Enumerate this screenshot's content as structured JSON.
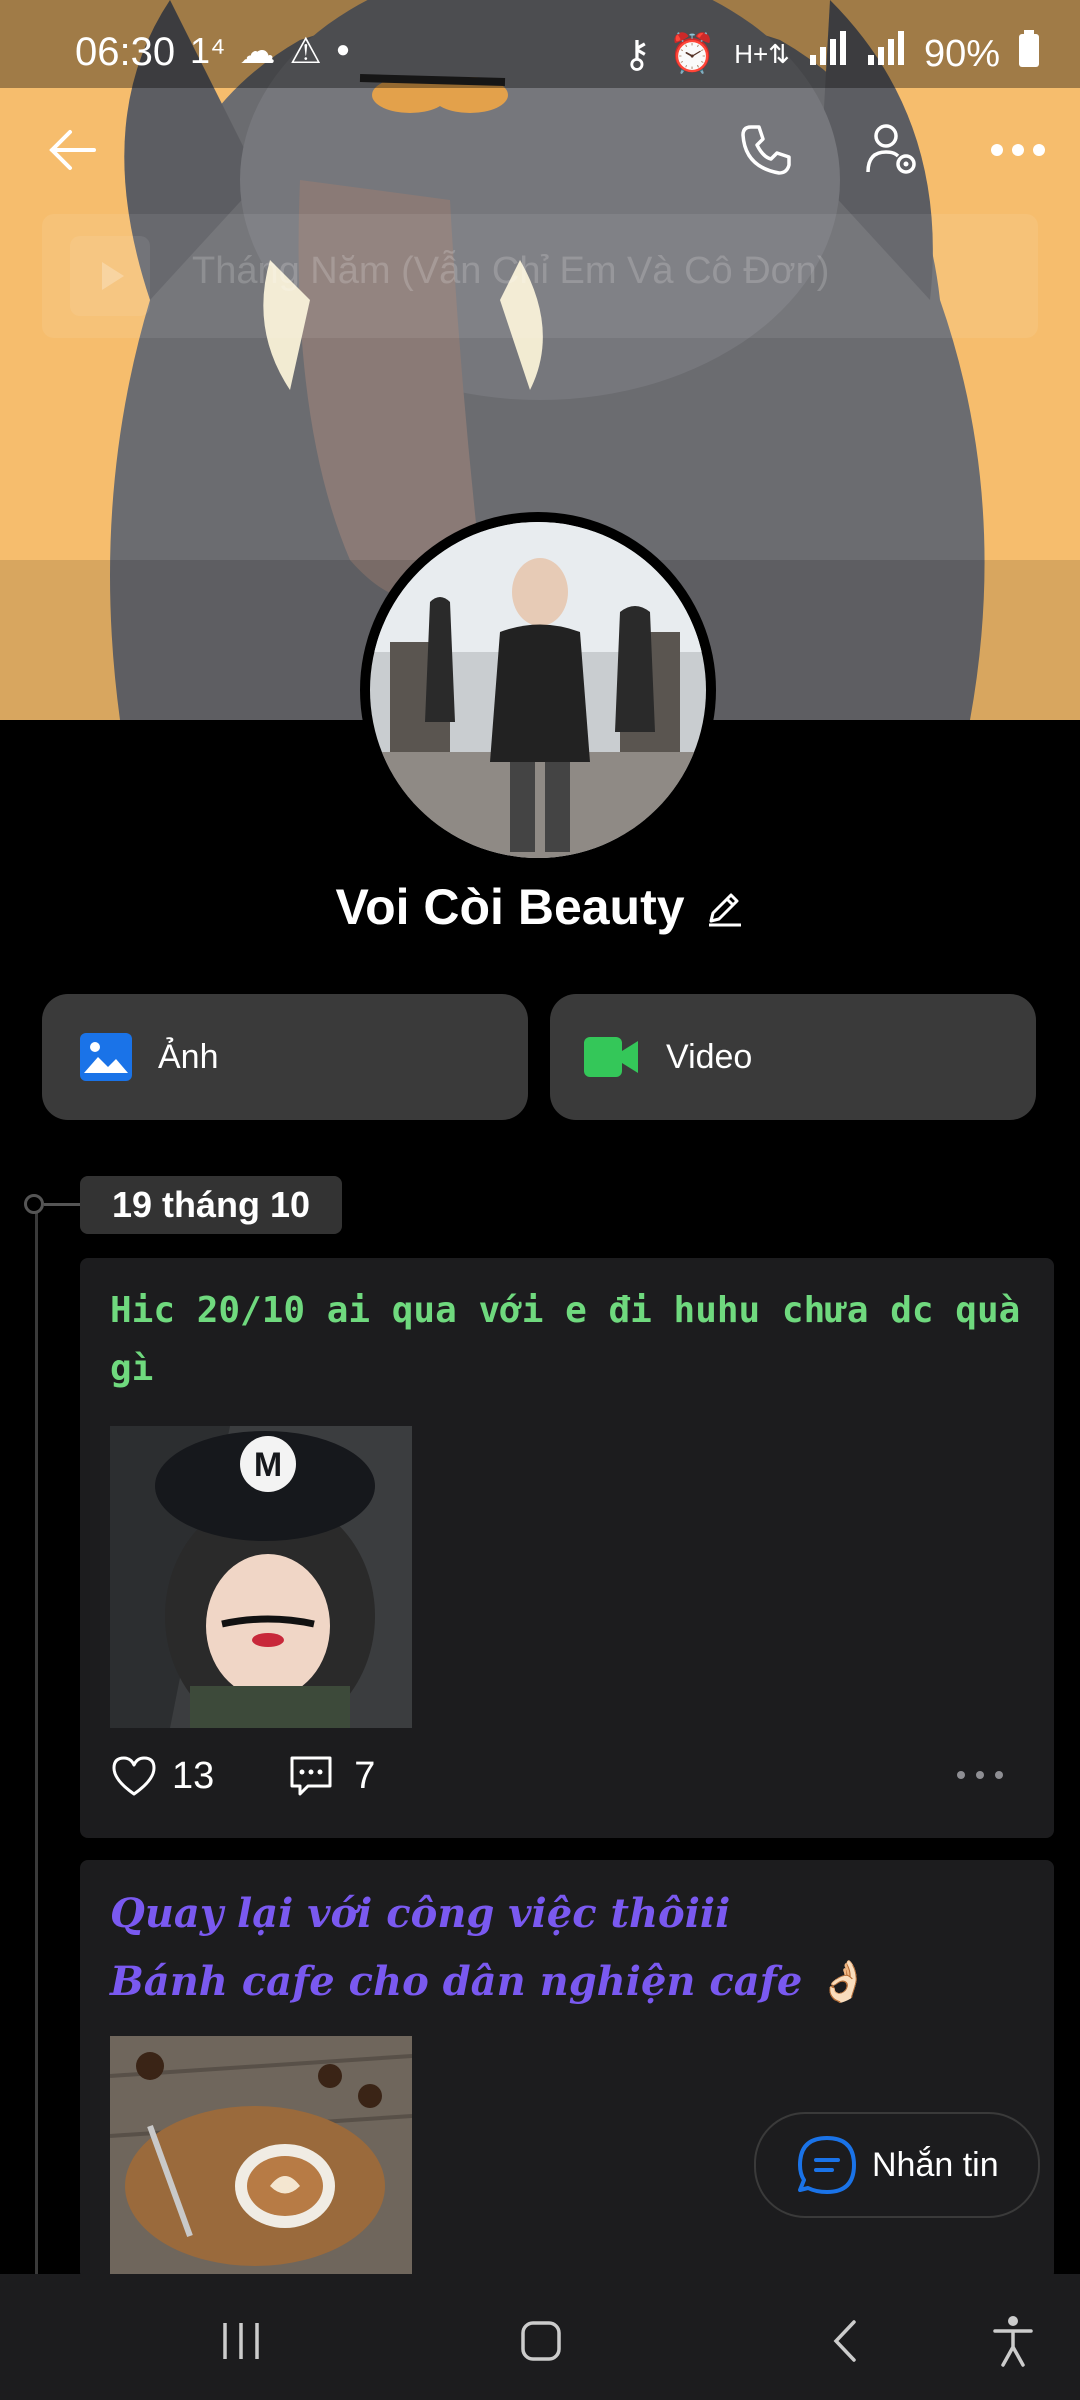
{
  "status_bar": {
    "time": "06:30",
    "notif_text": "1⁴",
    "battery": "90%"
  },
  "music": {
    "title": "Tháng Năm (Vẫn Chỉ Em Và Cô Đơn)"
  },
  "profile": {
    "name": "Voi Còi Beauty"
  },
  "media_buttons": [
    {
      "label": "Ảnh",
      "color": "#1a73e8"
    },
    {
      "label": "Video",
      "color": "#34c759"
    }
  ],
  "timeline": {
    "date": "19 tháng 10"
  },
  "posts": [
    {
      "text": "Hic 20/10 ai qua với e đi huhu chưa dc quà gì",
      "likes": "13",
      "comments": "7"
    },
    {
      "line1": "Quay lại với công việc thôiii",
      "line2": "Bánh cafe cho dân nghiện cafe 👌🏻"
    }
  ],
  "message_button": {
    "label": "Nhắn tin"
  },
  "colors": {
    "accent": "#1a73e8",
    "post1_text": "#6fd97e",
    "post2_text": "#7a59f0"
  }
}
